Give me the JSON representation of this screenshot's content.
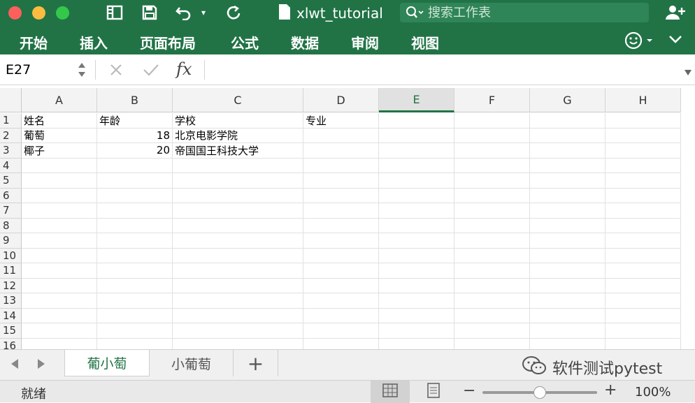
{
  "window": {
    "title": "xlwt_tutorial"
  },
  "search": {
    "placeholder": "搜索工作表"
  },
  "ribbon": {
    "tabs": [
      "开始",
      "插入",
      "页面布局",
      "公式",
      "数据",
      "审阅",
      "视图"
    ]
  },
  "formula_bar": {
    "name_box": "E27",
    "fx_label": "fx",
    "formula": ""
  },
  "columns": [
    "A",
    "B",
    "C",
    "D",
    "E",
    "F",
    "G",
    "H"
  ],
  "selected_column": "E",
  "rows": [
    "1",
    "2",
    "3",
    "4",
    "5",
    "6",
    "7",
    "8",
    "9",
    "10",
    "11",
    "12",
    "13",
    "14",
    "15",
    "16"
  ],
  "cells": {
    "A1": "姓名",
    "B1": "年龄",
    "C1": "学校",
    "D1": "专业",
    "A2": "葡萄",
    "B2": "18",
    "C2": "北京电影学院",
    "A3": "椰子",
    "B3": "20",
    "C3": "帝国国王科技大学"
  },
  "sheets": [
    {
      "name": "葡小萄",
      "active": true
    },
    {
      "name": "小葡萄",
      "active": false
    }
  ],
  "add_sheet": "+",
  "watermark": "软件测试pytest",
  "status": {
    "text": "就绪",
    "zoom": "100%",
    "zoom_minus": "−",
    "zoom_plus": "+",
    "zoom_fraction": 0.5
  },
  "colors": {
    "accent": "#217346",
    "close": "#fc605c",
    "minimize": "#fdbc40",
    "maximize": "#34c84a"
  }
}
